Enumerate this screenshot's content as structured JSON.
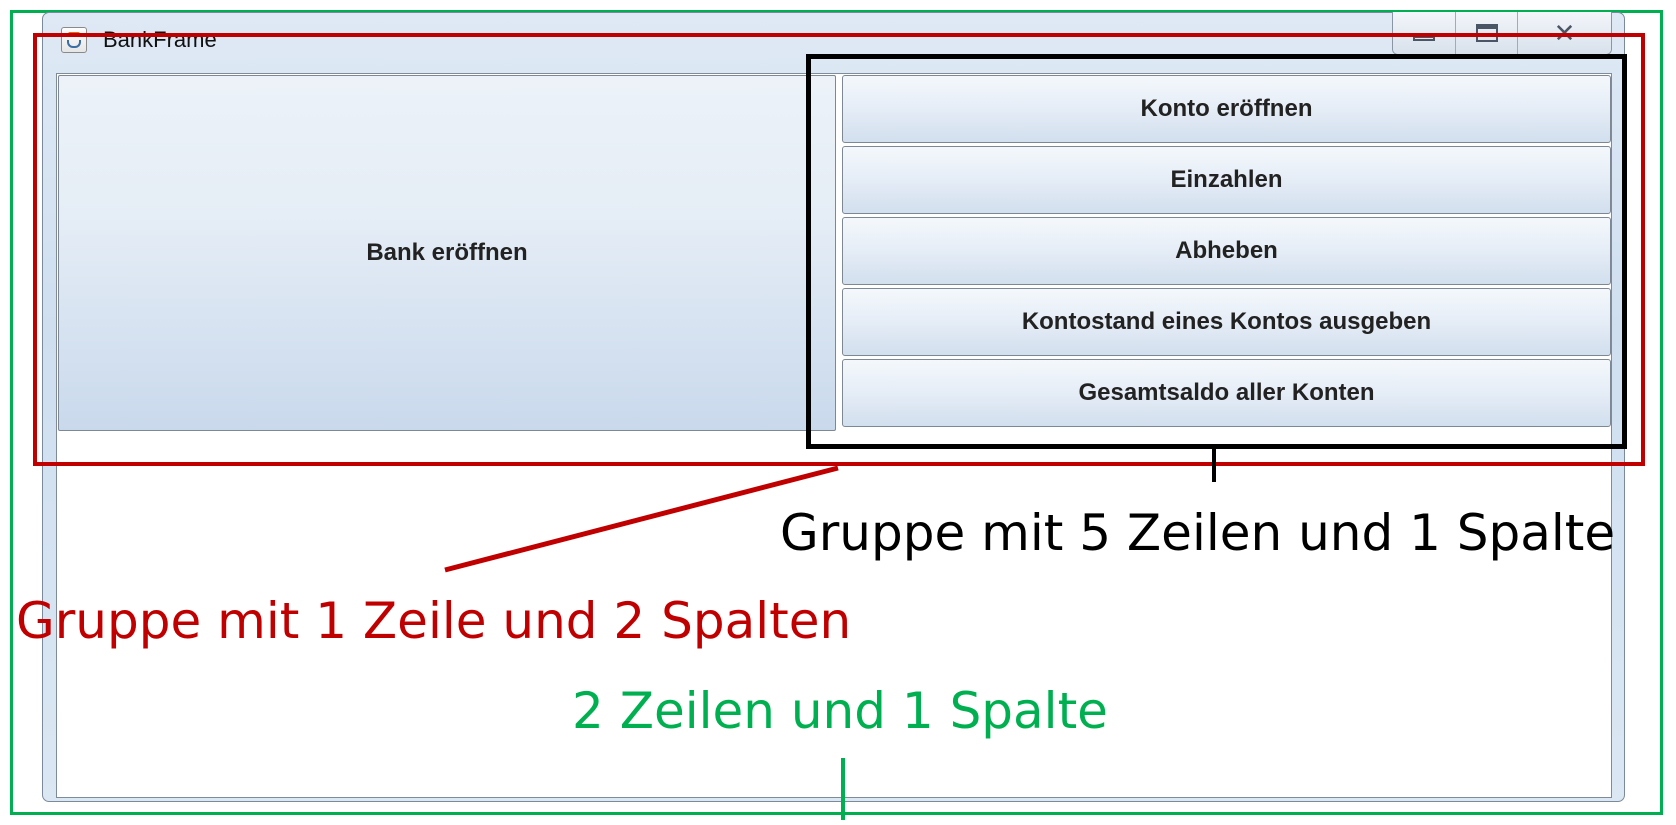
{
  "window": {
    "title": "BankFrame",
    "controls": [
      "minimize-icon",
      "maximize-icon",
      "close-icon"
    ]
  },
  "buttons": {
    "bank_open": "Bank eröffnen",
    "right_column": [
      "Konto eröffnen",
      "Einzahlen",
      "Abheben",
      "Kontostand eines Kontos ausgeben",
      "Gesamtsaldo aller Konten"
    ]
  },
  "annotations": {
    "black_label": "Gruppe mit 5 Zeilen und 1 Spalte",
    "red_label": "Gruppe mit 1 Zeile und 2 Spalten",
    "green_label": "2 Zeilen und 1 Spalte"
  },
  "colors": {
    "red": "#c00000",
    "green": "#00b050",
    "black": "#000000"
  }
}
